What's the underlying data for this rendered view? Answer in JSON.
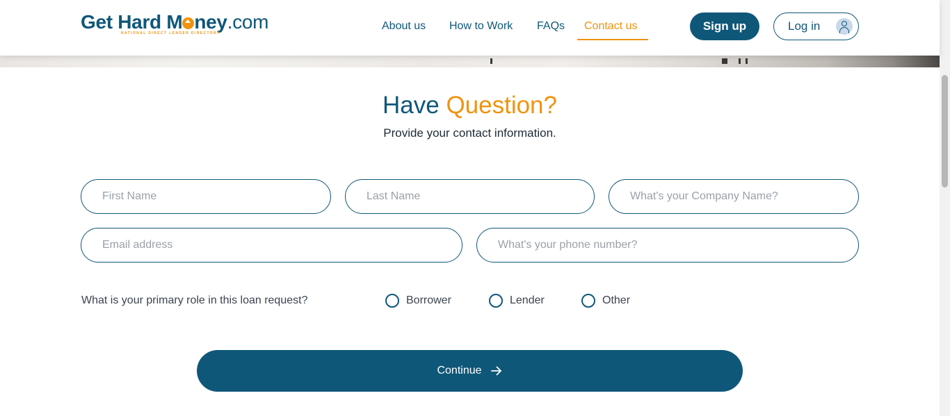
{
  "brand": {
    "name_part1": "Get Hard M",
    "name_part2": "ney",
    "tld": ".com",
    "tagline": "NATIONAL DIRECT LENDER DIRECTORY",
    "primary_color": "#0f5779",
    "accent_color": "#f0930e"
  },
  "nav": {
    "items": [
      {
        "label": "About us",
        "active": false
      },
      {
        "label": "How to Work",
        "active": false
      },
      {
        "label": "FAQs",
        "active": false
      },
      {
        "label": "Contact us",
        "active": true
      }
    ]
  },
  "auth": {
    "signup_label": "Sign up",
    "login_label": "Log in",
    "login_icon": "user-avatar-icon"
  },
  "heading": {
    "title_part1": "Have",
    "title_part2": "Question?",
    "subtitle": "Provide your contact information."
  },
  "form": {
    "first_name": {
      "value": "",
      "placeholder": "First Name"
    },
    "last_name": {
      "value": "",
      "placeholder": "Last Name"
    },
    "company": {
      "value": "",
      "placeholder": "What's your Company Name?"
    },
    "email": {
      "value": "",
      "placeholder": "Email address"
    },
    "phone": {
      "value": "",
      "placeholder": "What's your phone number?"
    },
    "role_question": "What is your primary role in this loan request?",
    "role_options": [
      {
        "label": "Borrower",
        "selected": false
      },
      {
        "label": "Lender",
        "selected": false
      },
      {
        "label": "Other",
        "selected": false
      }
    ],
    "submit_label": "Continue",
    "submit_icon": "arrow-right-icon"
  }
}
